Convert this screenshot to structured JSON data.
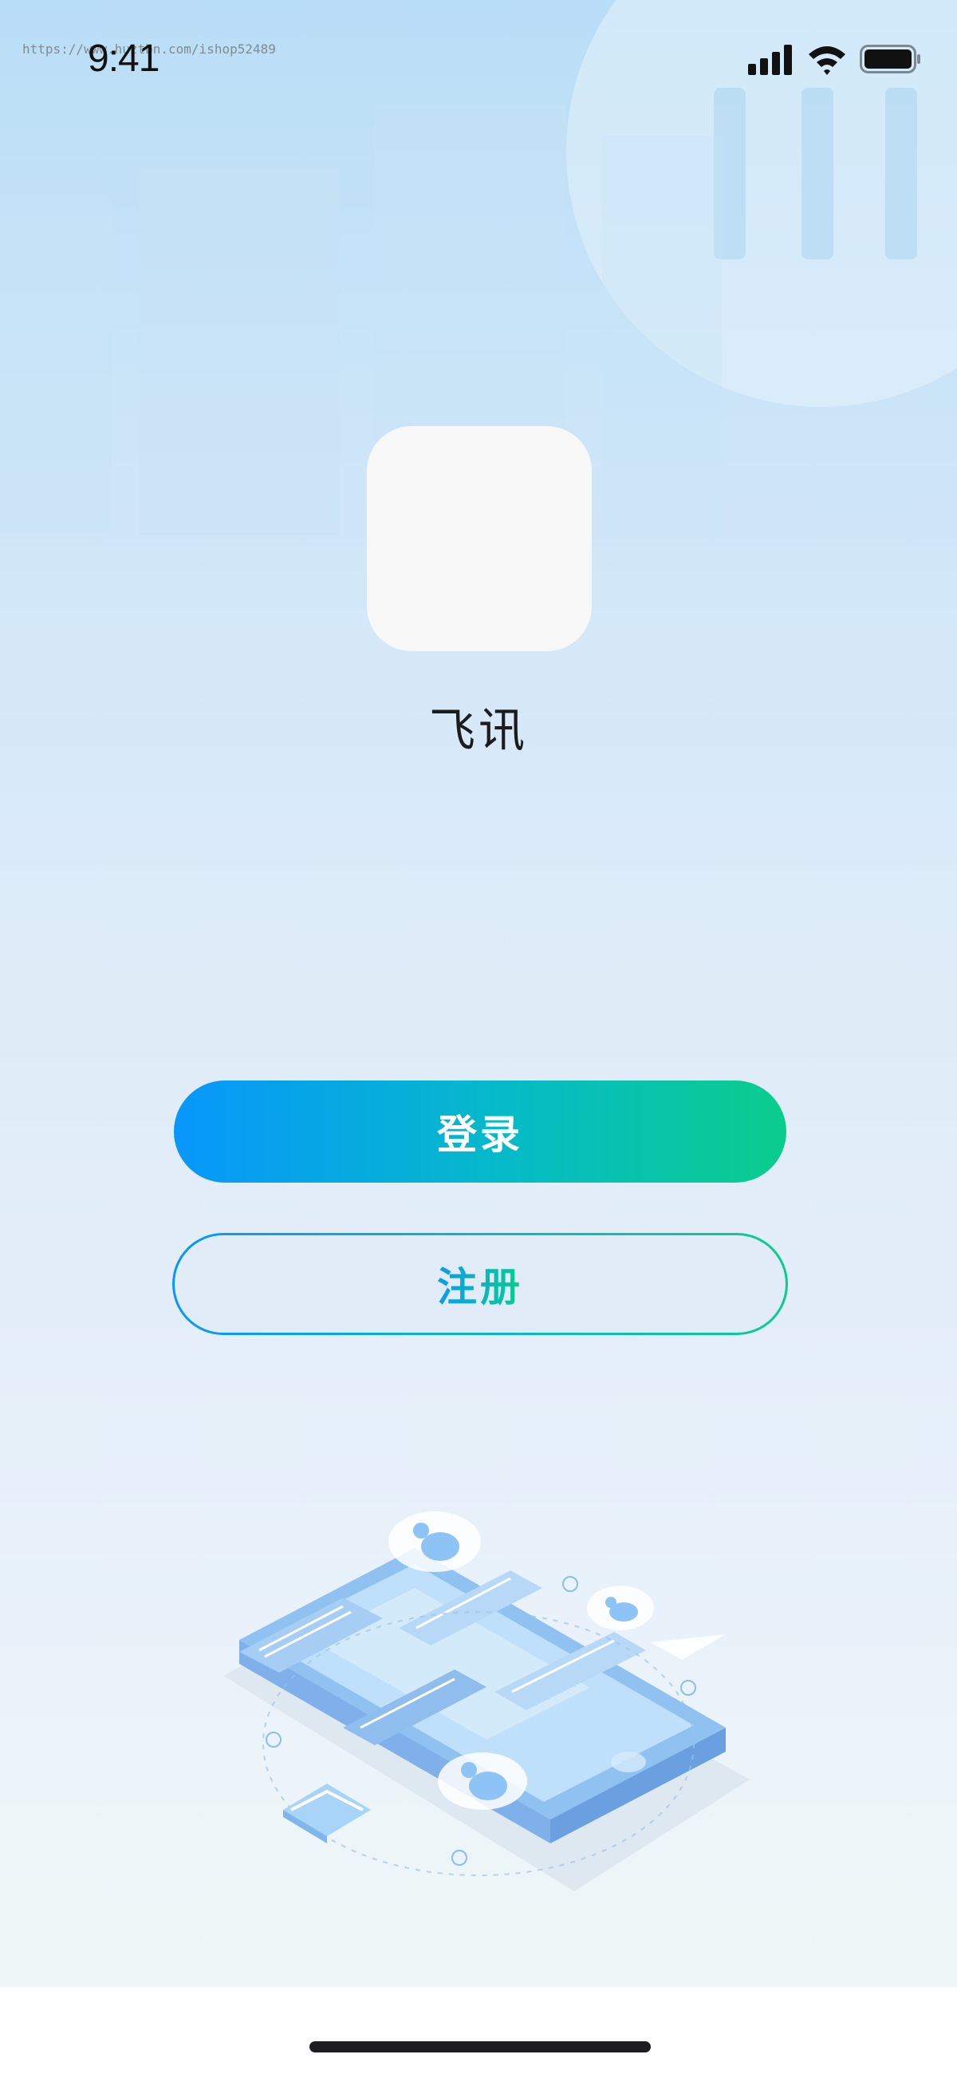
{
  "status_bar": {
    "time": "9:41",
    "watermark": "https://www.huztbn.com/ishop52489",
    "icons": [
      "signal-icon",
      "wifi-icon",
      "battery-icon"
    ]
  },
  "app": {
    "name": "飞讯"
  },
  "actions": {
    "login_label": "登录",
    "register_label": "注册"
  },
  "colors": {
    "gradient_start": "#0797fb",
    "gradient_end": "#0acd8c",
    "background_top": "#b9def7",
    "background_bottom": "#eef7f6"
  }
}
